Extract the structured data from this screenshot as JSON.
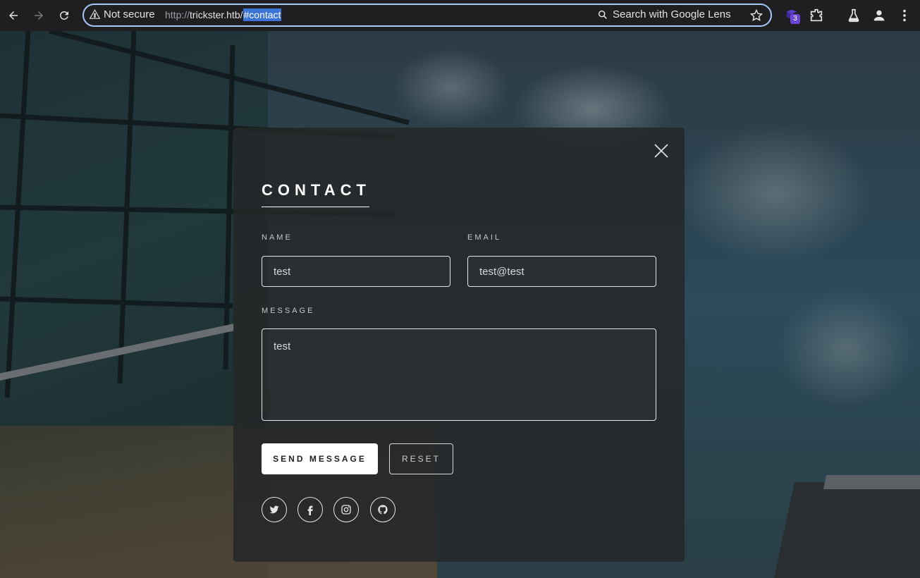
{
  "browser": {
    "security_label": "Not secure",
    "url_scheme": "http://",
    "url_host": "trickster.htb/",
    "url_fragment": "#contact",
    "lens_label": "Search with Google Lens",
    "extension_badge": "3",
    "icons": [
      "back-icon",
      "forward-icon",
      "reload-icon",
      "warning-icon",
      "search-icon",
      "star-icon",
      "extension-icon",
      "puzzle-icon",
      "labs-icon",
      "profile-icon",
      "menu-icon"
    ]
  },
  "contact": {
    "title": "CONTACT",
    "name_label": "NAME",
    "name_value": "test",
    "email_label": "EMAIL",
    "email_value": "test@test",
    "message_label": "MESSAGE",
    "message_value": "test",
    "send_label": "SEND MESSAGE",
    "reset_label": "RESET",
    "socials": [
      "twitter-icon",
      "facebook-icon",
      "instagram-icon",
      "github-icon"
    ]
  },
  "colors": {
    "accent_focus": "#a8c7fa",
    "highlight": "#3b74d6",
    "badge": "#6e46d6"
  }
}
